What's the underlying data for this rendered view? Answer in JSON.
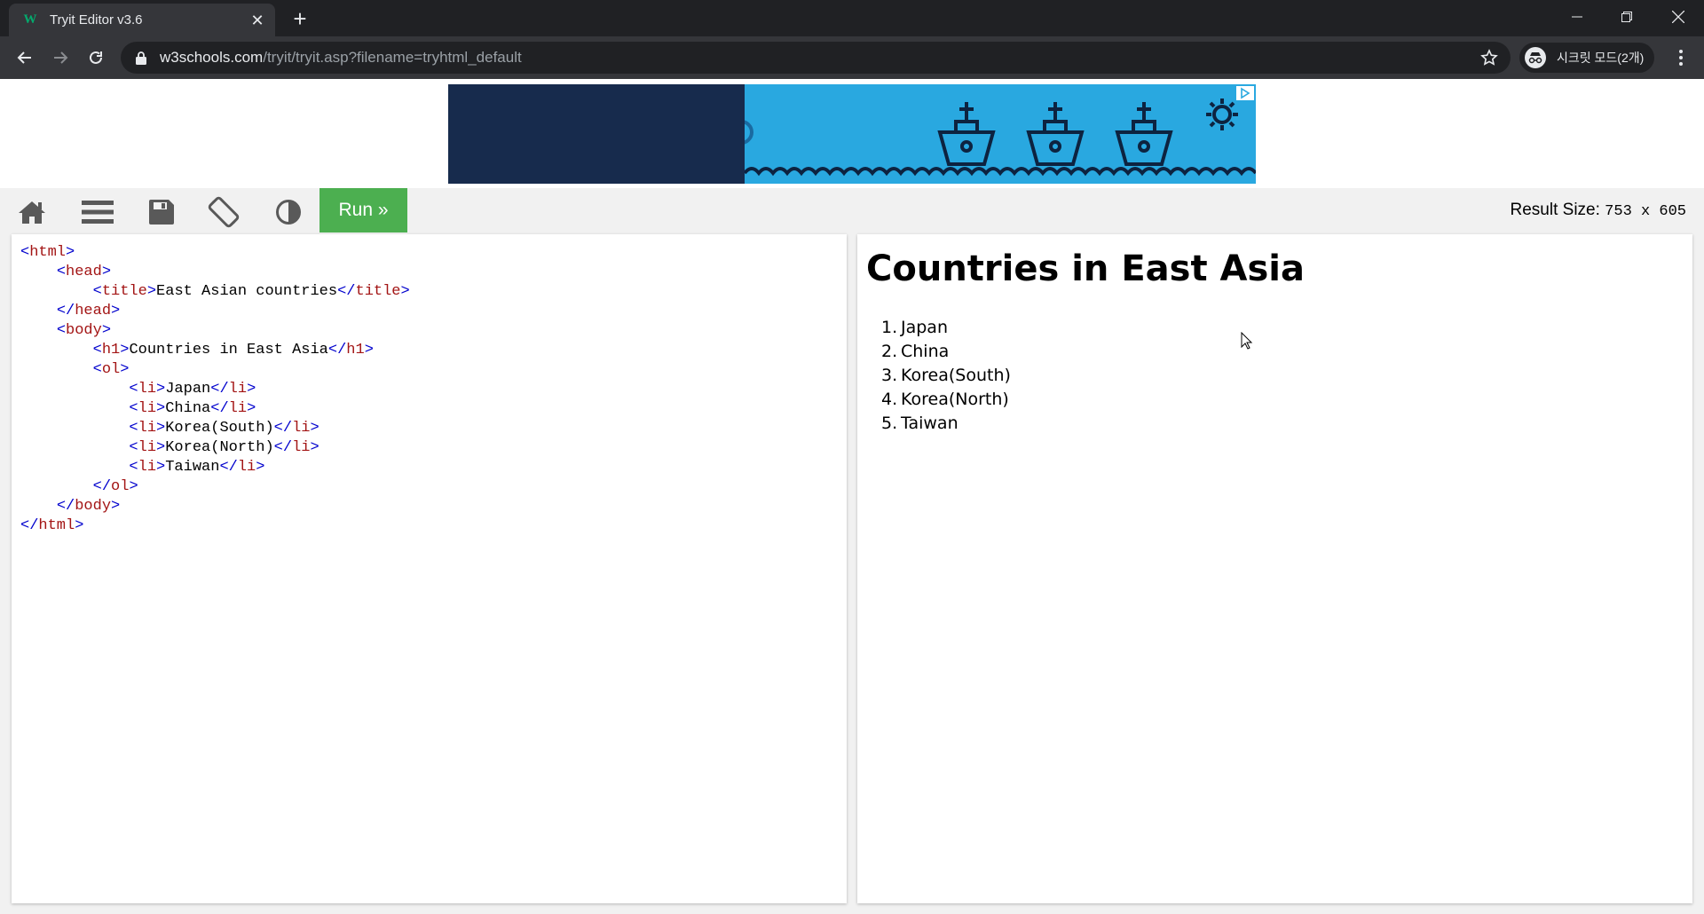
{
  "browser": {
    "tab_title": "Tryit Editor v3.6",
    "tab_favicon_text": "W",
    "url_host": "w3schools.com",
    "url_path": "/tryit/tryit.asp?filename=tryhtml_default",
    "incognito_label": "시크릿 모드(2개)"
  },
  "tryit": {
    "run_label": "Run »",
    "result_size_label": "Result Size:",
    "result_size_value": "753 x 605"
  },
  "code_lines": [
    [
      {
        "t": "b",
        "v": "<"
      },
      {
        "t": "g",
        "v": "html"
      },
      {
        "t": "b",
        "v": ">"
      }
    ],
    [
      {
        "t": "s",
        "v": "    "
      },
      {
        "t": "b",
        "v": "<"
      },
      {
        "t": "g",
        "v": "head"
      },
      {
        "t": "b",
        "v": ">"
      }
    ],
    [
      {
        "t": "s",
        "v": "        "
      },
      {
        "t": "b",
        "v": "<"
      },
      {
        "t": "g",
        "v": "title"
      },
      {
        "t": "b",
        "v": ">"
      },
      {
        "t": "x",
        "v": "East Asian countries"
      },
      {
        "t": "b",
        "v": "</"
      },
      {
        "t": "g",
        "v": "title"
      },
      {
        "t": "b",
        "v": ">"
      }
    ],
    [
      {
        "t": "s",
        "v": "    "
      },
      {
        "t": "b",
        "v": "</"
      },
      {
        "t": "g",
        "v": "head"
      },
      {
        "t": "b",
        "v": ">"
      }
    ],
    [
      {
        "t": "s",
        "v": "    "
      },
      {
        "t": "b",
        "v": "<"
      },
      {
        "t": "g",
        "v": "body"
      },
      {
        "t": "b",
        "v": ">"
      }
    ],
    [
      {
        "t": "s",
        "v": "        "
      },
      {
        "t": "b",
        "v": "<"
      },
      {
        "t": "g",
        "v": "h1"
      },
      {
        "t": "b",
        "v": ">"
      },
      {
        "t": "x",
        "v": "Countries in East Asia"
      },
      {
        "t": "b",
        "v": "</"
      },
      {
        "t": "g",
        "v": "h1"
      },
      {
        "t": "b",
        "v": ">"
      }
    ],
    [
      {
        "t": "s",
        "v": "        "
      },
      {
        "t": "b",
        "v": "<"
      },
      {
        "t": "g",
        "v": "ol"
      },
      {
        "t": "b",
        "v": ">"
      }
    ],
    [
      {
        "t": "s",
        "v": "            "
      },
      {
        "t": "b",
        "v": "<"
      },
      {
        "t": "g",
        "v": "li"
      },
      {
        "t": "b",
        "v": ">"
      },
      {
        "t": "x",
        "v": "Japan"
      },
      {
        "t": "b",
        "v": "</"
      },
      {
        "t": "g",
        "v": "li"
      },
      {
        "t": "b",
        "v": ">"
      }
    ],
    [
      {
        "t": "s",
        "v": "            "
      },
      {
        "t": "b",
        "v": "<"
      },
      {
        "t": "g",
        "v": "li"
      },
      {
        "t": "b",
        "v": ">"
      },
      {
        "t": "x",
        "v": "China"
      },
      {
        "t": "b",
        "v": "</"
      },
      {
        "t": "g",
        "v": "li"
      },
      {
        "t": "b",
        "v": ">"
      }
    ],
    [
      {
        "t": "s",
        "v": "            "
      },
      {
        "t": "b",
        "v": "<"
      },
      {
        "t": "g",
        "v": "li"
      },
      {
        "t": "b",
        "v": ">"
      },
      {
        "t": "x",
        "v": "Korea(South)"
      },
      {
        "t": "b",
        "v": "</"
      },
      {
        "t": "g",
        "v": "li"
      },
      {
        "t": "b",
        "v": ">"
      }
    ],
    [
      {
        "t": "s",
        "v": "            "
      },
      {
        "t": "b",
        "v": "<"
      },
      {
        "t": "g",
        "v": "li"
      },
      {
        "t": "b",
        "v": ">"
      },
      {
        "t": "x",
        "v": "Korea(North)"
      },
      {
        "t": "b",
        "v": "</"
      },
      {
        "t": "g",
        "v": "li"
      },
      {
        "t": "b",
        "v": ">"
      }
    ],
    [
      {
        "t": "s",
        "v": "            "
      },
      {
        "t": "b",
        "v": "<"
      },
      {
        "t": "g",
        "v": "li"
      },
      {
        "t": "b",
        "v": ">"
      },
      {
        "t": "x",
        "v": "Taiwan"
      },
      {
        "t": "b",
        "v": "</"
      },
      {
        "t": "g",
        "v": "li"
      },
      {
        "t": "b",
        "v": ">"
      }
    ],
    [
      {
        "t": "s",
        "v": "        "
      },
      {
        "t": "b",
        "v": "</"
      },
      {
        "t": "g",
        "v": "ol"
      },
      {
        "t": "b",
        "v": ">"
      }
    ],
    [
      {
        "t": "s",
        "v": "    "
      },
      {
        "t": "b",
        "v": "</"
      },
      {
        "t": "g",
        "v": "body"
      },
      {
        "t": "b",
        "v": ">"
      }
    ],
    [
      {
        "t": "b",
        "v": "</"
      },
      {
        "t": "g",
        "v": "html"
      },
      {
        "t": "b",
        "v": ">"
      }
    ]
  ],
  "result": {
    "heading": "Countries in East Asia",
    "items": [
      {
        "num": "1.",
        "label": "Japan"
      },
      {
        "num": "2.",
        "label": "China"
      },
      {
        "num": "3.",
        "label": "Korea(South)"
      },
      {
        "num": "4.",
        "label": "Korea(North)"
      },
      {
        "num": "5.",
        "label": "Taiwan"
      }
    ]
  },
  "colors": {
    "run_button": "#4caf50",
    "code_tag": "#a31515",
    "code_bracket": "#0000cd",
    "ad_dark": "#172b4d",
    "ad_light": "#29a8e0"
  }
}
